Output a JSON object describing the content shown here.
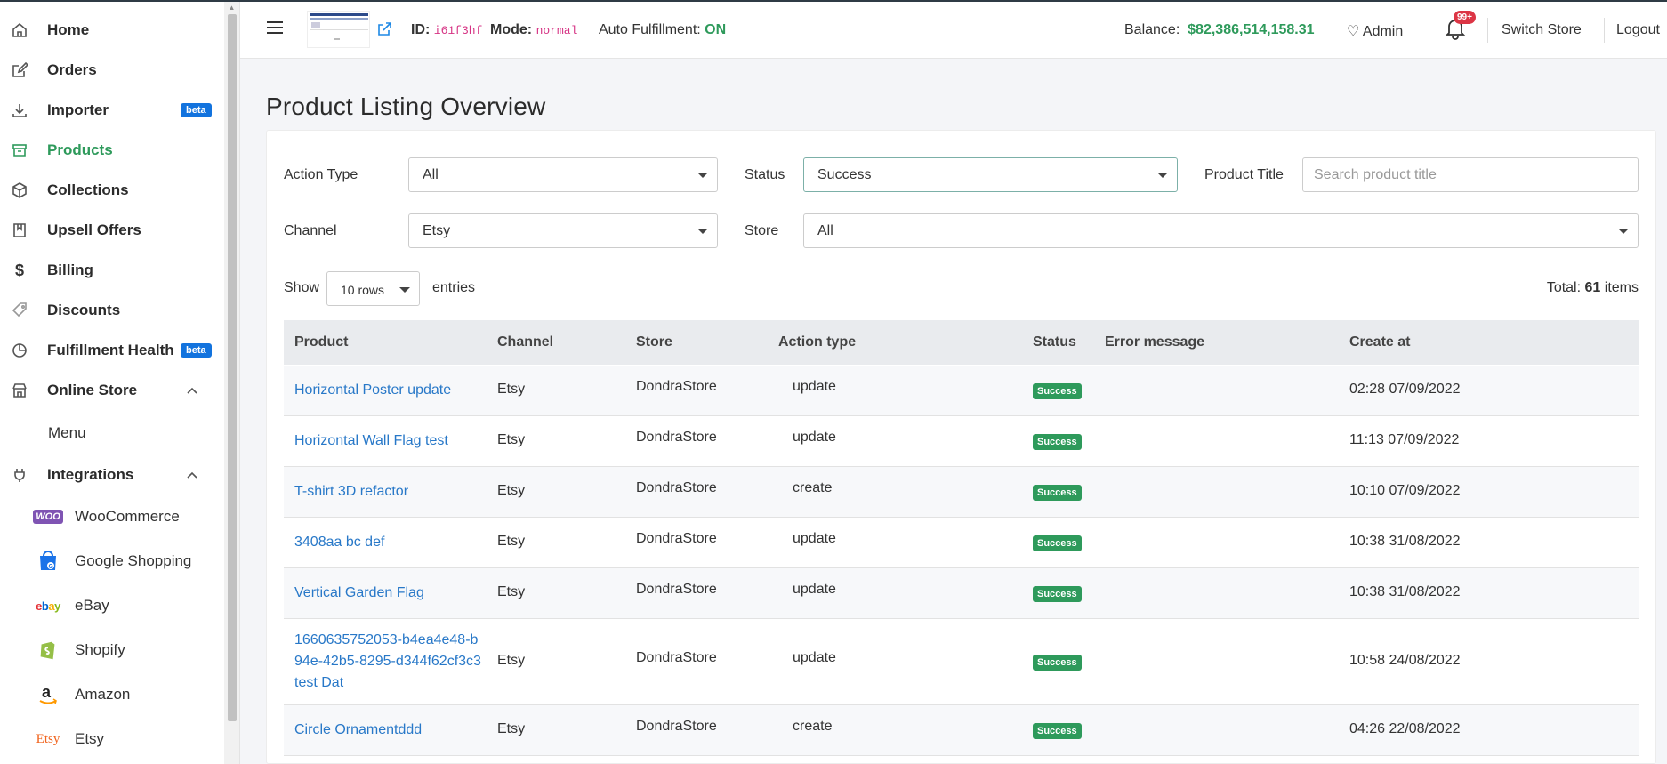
{
  "sidebar": {
    "items": [
      {
        "label": "Home"
      },
      {
        "label": "Orders"
      },
      {
        "label": "Importer",
        "badge": "beta"
      },
      {
        "label": "Products"
      },
      {
        "label": "Collections"
      },
      {
        "label": "Upsell Offers"
      },
      {
        "label": "Billing"
      },
      {
        "label": "Discounts"
      },
      {
        "label": "Fulfillment Health",
        "badge": "beta"
      },
      {
        "label": "Online Store"
      },
      {
        "label": "Menu"
      },
      {
        "label": "Integrations"
      }
    ],
    "integrations": [
      {
        "label": "WooCommerce"
      },
      {
        "label": "Google Shopping"
      },
      {
        "label": "eBay"
      },
      {
        "label": "Shopify"
      },
      {
        "label": "Amazon"
      },
      {
        "label": "Etsy"
      }
    ]
  },
  "header": {
    "id_label": "ID:",
    "id_value": "i61f3hf",
    "mode_label": "Mode:",
    "mode_value": "normal",
    "auto_label": "Auto Fulfillment:",
    "auto_value": "ON",
    "balance_label": "Balance:",
    "balance_value": "$82,386,514,158.31",
    "admin_label": "Admin",
    "notif_badge": "99+",
    "switch_store": "Switch Store",
    "logout": "Logout"
  },
  "page": {
    "title": "Product Listing Overview"
  },
  "filters": {
    "action_type_label": "Action Type",
    "action_type_value": "All",
    "status_label": "Status",
    "status_value": "Success",
    "product_title_label": "Product Title",
    "product_title_placeholder": "Search product title",
    "channel_label": "Channel",
    "channel_value": "Etsy",
    "store_label": "Store",
    "store_value": "All"
  },
  "entries": {
    "show_label": "Show",
    "rows_value": "10 rows",
    "entries_label": "entries",
    "total_label": "Total:",
    "total_count": "61",
    "total_suffix": "items"
  },
  "table": {
    "columns": [
      "Product",
      "Channel",
      "Store",
      "Action type",
      "Status",
      "Error message",
      "Create at"
    ],
    "rows": [
      {
        "product": "Horizontal Poster update",
        "channel": "Etsy",
        "store": "DondraStore",
        "action": "update",
        "status": "Success",
        "error": "",
        "created": "02:28 07/09/2022"
      },
      {
        "product": "Horizontal Wall Flag test",
        "channel": "Etsy",
        "store": "DondraStore",
        "action": "update",
        "status": "Success",
        "error": "",
        "created": "11:13 07/09/2022"
      },
      {
        "product": "T-shirt 3D refactor",
        "channel": "Etsy",
        "store": "DondraStore",
        "action": "create",
        "status": "Success",
        "error": "",
        "created": "10:10 07/09/2022"
      },
      {
        "product": "3408aa bc def",
        "channel": "Etsy",
        "store": "DondraStore",
        "action": "update",
        "status": "Success",
        "error": "",
        "created": "10:38 31/08/2022"
      },
      {
        "product": "Vertical Garden Flag",
        "channel": "Etsy",
        "store": "DondraStore",
        "action": "update",
        "status": "Success",
        "error": "",
        "created": "10:38 31/08/2022"
      },
      {
        "product": "1660635752053-b4ea4e48-b94e-42b5-8295-d344f62cf3c3 test Dat",
        "channel": "Etsy",
        "store": "DondraStore",
        "action": "update",
        "status": "Success",
        "error": "",
        "created": "10:58 24/08/2022"
      },
      {
        "product": "Circle Ornamentddd",
        "channel": "Etsy",
        "store": "DondraStore",
        "action": "create",
        "status": "Success",
        "error": "",
        "created": "04:26 22/08/2022"
      }
    ]
  }
}
